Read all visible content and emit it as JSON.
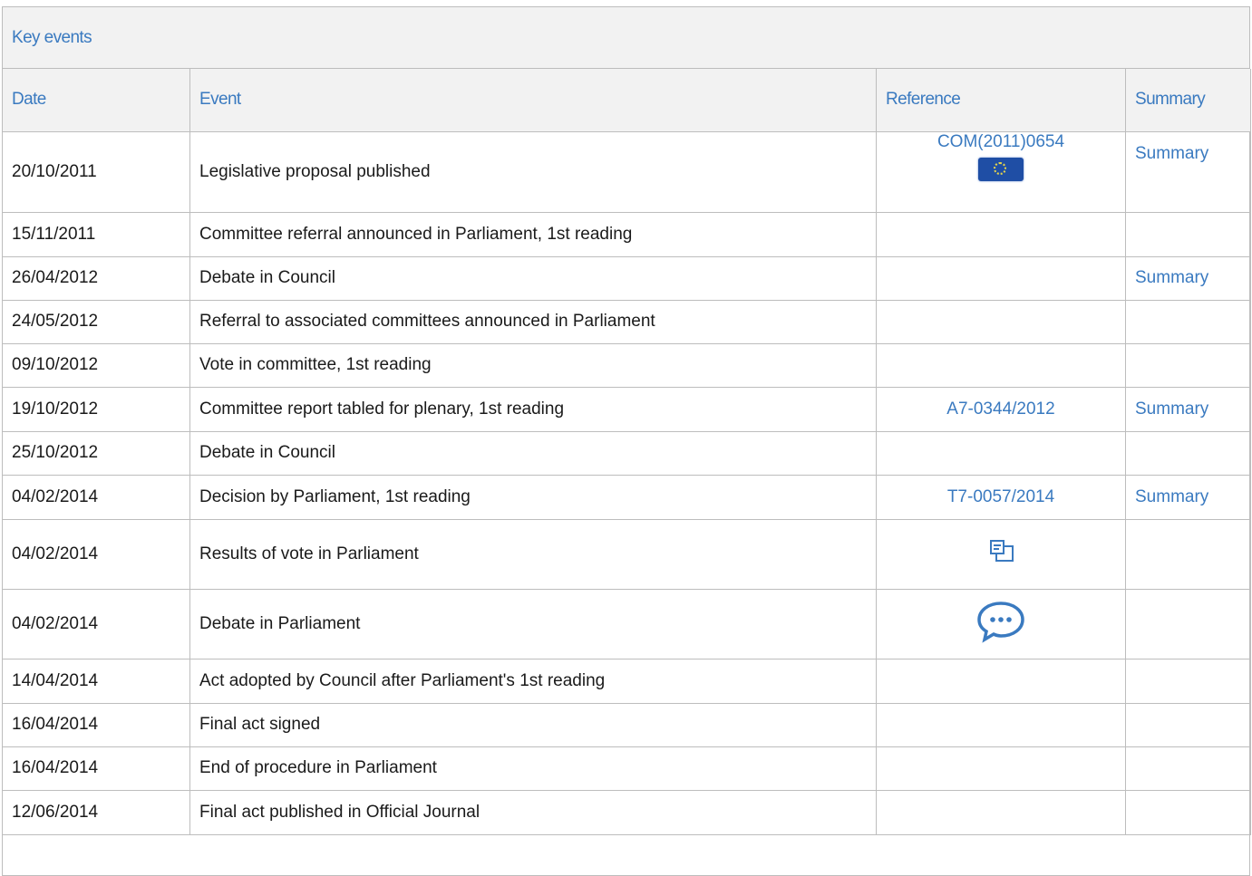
{
  "panel": {
    "title": "Key events"
  },
  "table": {
    "headers": {
      "date": "Date",
      "event": "Event",
      "reference": "Reference",
      "summary": "Summary"
    },
    "rows": [
      {
        "date": "20/10/2011",
        "event": "Legislative proposal published",
        "reference": "COM(2011)0654",
        "reference_icon": "eu-flag-icon",
        "summary": "Summary"
      },
      {
        "date": "15/11/2011",
        "event": "Committee referral announced in Parliament, 1st reading",
        "reference": "",
        "summary": ""
      },
      {
        "date": "26/04/2012",
        "event": "Debate in Council",
        "reference": "",
        "summary": "Summary"
      },
      {
        "date": "24/05/2012",
        "event": "Referral to associated committees announced in Parliament",
        "reference": "",
        "summary": ""
      },
      {
        "date": "09/10/2012",
        "event": "Vote in committee, 1st reading",
        "reference": "",
        "summary": ""
      },
      {
        "date": "19/10/2012",
        "event": "Committee report tabled for plenary, 1st reading",
        "reference": "A7-0344/2012",
        "summary": "Summary"
      },
      {
        "date": "25/10/2012",
        "event": "Debate in Council",
        "reference": "",
        "summary": ""
      },
      {
        "date": "04/02/2014",
        "event": "Decision by Parliament, 1st reading",
        "reference": "T7-0057/2014",
        "summary": "Summary"
      },
      {
        "date": "04/02/2014",
        "event": "Results of vote in Parliament",
        "reference_icon": "vote-results-icon",
        "summary": ""
      },
      {
        "date": "04/02/2014",
        "event": "Debate in Parliament",
        "reference_icon": "debate-speech-bubble-icon",
        "summary": ""
      },
      {
        "date": "14/04/2014",
        "event": "Act adopted by Council after Parliament's 1st reading",
        "reference": "",
        "summary": ""
      },
      {
        "date": "16/04/2014",
        "event": "Final act signed",
        "reference": "",
        "summary": ""
      },
      {
        "date": "16/04/2014",
        "event": "End of procedure in Parliament",
        "reference": "",
        "summary": ""
      },
      {
        "date": "12/06/2014",
        "event": "Final act published in Official Journal",
        "reference": "",
        "summary": ""
      }
    ]
  },
  "colors": {
    "link": "#3a7ac0",
    "header_bg": "#f2f2f2",
    "border": "#bdbdbd",
    "text": "#1a1a1a"
  }
}
